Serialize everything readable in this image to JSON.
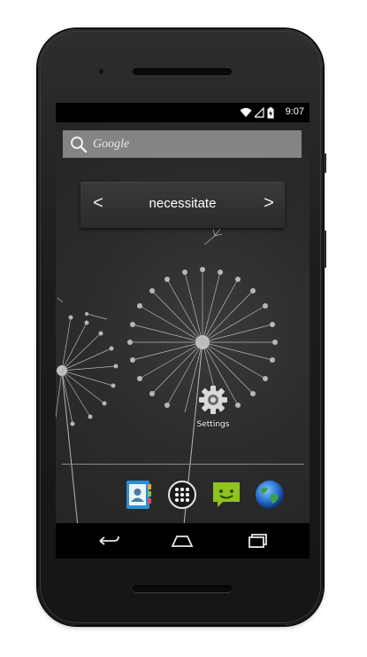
{
  "status_bar": {
    "time": "9:07",
    "icons": [
      "wifi-icon",
      "signal-icon",
      "battery-charging-icon"
    ]
  },
  "search": {
    "label": "Google",
    "icon": "search-icon"
  },
  "word_widget": {
    "word": "necessitate",
    "prev": "<",
    "next": ">"
  },
  "shortcuts": [
    {
      "label": "Settings",
      "icon": "settings-gear-icon"
    }
  ],
  "dock": {
    "apps": [
      {
        "name": "contacts-icon"
      },
      {
        "name": "app-drawer-icon"
      },
      {
        "name": "messaging-icon"
      },
      {
        "name": "browser-globe-icon"
      }
    ]
  },
  "nav_bar": [
    "back-icon",
    "home-icon",
    "recents-icon"
  ],
  "colors": {
    "screen_bg": "#2d2d2d",
    "status_bar": "#000000",
    "messaging_green": "#8fc31f",
    "globe_blue": "#2a6fd1"
  }
}
